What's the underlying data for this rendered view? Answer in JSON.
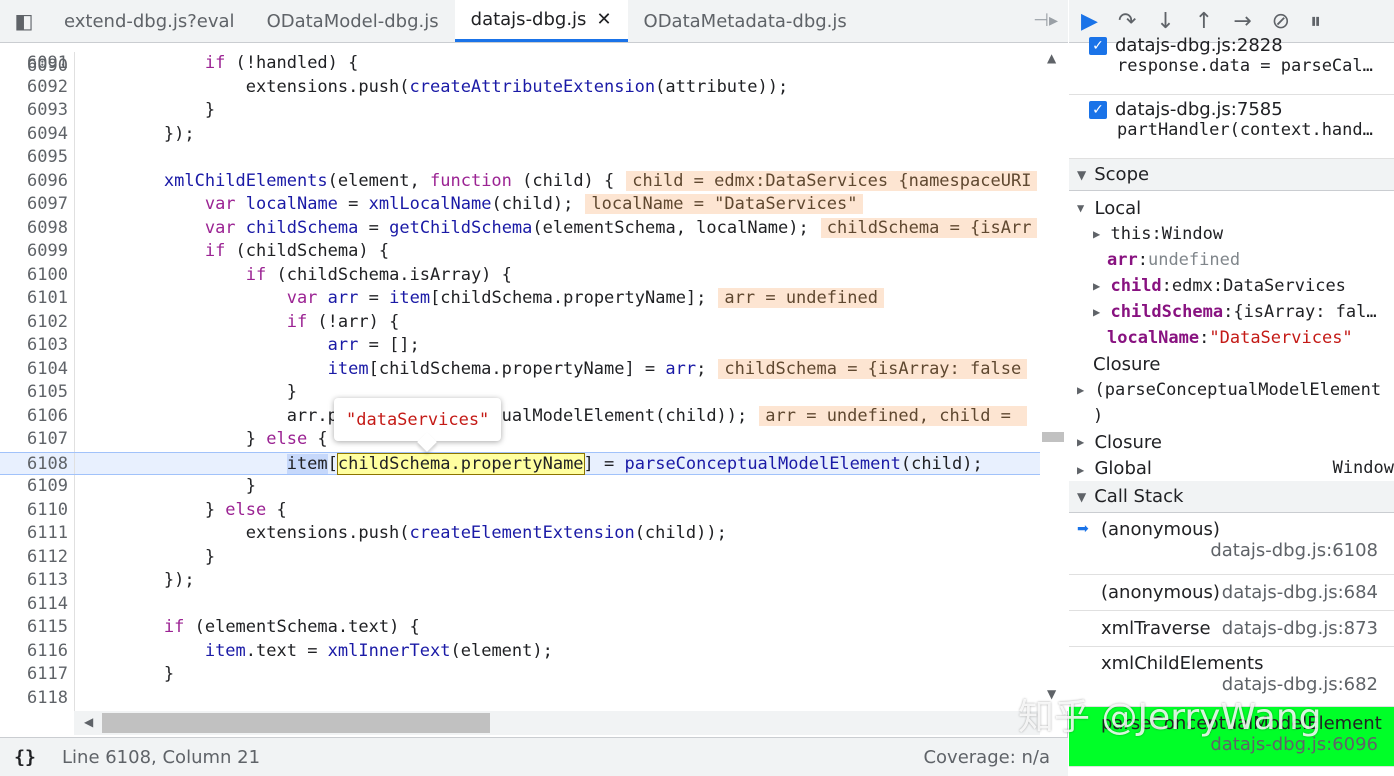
{
  "tabs": [
    {
      "label": "extend-dbg.js?eval",
      "active": false
    },
    {
      "label": "ODataModel-dbg.js",
      "active": false
    },
    {
      "label": "datajs-dbg.js",
      "active": true,
      "close": "✕"
    },
    {
      "label": "ODataMetadata-dbg.js",
      "active": false
    }
  ],
  "code_top_partial": "6090",
  "code_lines": [
    {
      "n": "6091",
      "html": "            <span class='kw'>if</span> (!handled) {"
    },
    {
      "n": "6092",
      "html": "                extensions.push(<span class='fn'>createAttributeExtension</span>(attribute));"
    },
    {
      "n": "6093",
      "html": "            }"
    },
    {
      "n": "6094",
      "html": "        });"
    },
    {
      "n": "6095",
      "html": ""
    },
    {
      "n": "6096",
      "html": "        <span class='fn'>xmlChildElements</span>(element, <span class='kw'>function</span> (child) {<span class='inl'>child = edmx:DataServices {namespaceURI</span>"
    },
    {
      "n": "6097",
      "html": "            <span class='kw'>var</span> <span class='vf'>localName</span> = <span class='fn'>xmlLocalName</span>(child);<span class='inl'>localName = \"DataServices\"</span>"
    },
    {
      "n": "6098",
      "html": "            <span class='kw'>var</span> <span class='vf'>childSchema</span> = <span class='fn'>getChildSchema</span>(elementSchema, localName);<span class='inl'>childSchema = {isArr</span>"
    },
    {
      "n": "6099",
      "html": "            <span class='kw'>if</span> (childSchema) {"
    },
    {
      "n": "6100",
      "html": "                <span class='kw'>if</span> (childSchema.isArray) {"
    },
    {
      "n": "6101",
      "html": "                    <span class='kw'>var</span> <span class='vf'>arr</span> = <span class='vf'>item</span>[childSchema.propertyName];<span class='inl'>arr = undefined</span>"
    },
    {
      "n": "6102",
      "html": "                    <span class='kw'>if</span> (!arr) {"
    },
    {
      "n": "6103",
      "html": "                        <span class='vf'>arr</span> = [];"
    },
    {
      "n": "6104",
      "html": "                        <span class='vf'>item</span>[childSchema.propertyName] = <span class='vf'>arr</span>;<span class='inl'>childSchema = {isArray: false</span>"
    },
    {
      "n": "6105",
      "html": "                    }"
    },
    {
      "n": "6106",
      "html": "                    arr.push(parseConceptualModelElement(child));<span class='inl'>arr = undefined, child = </span>"
    },
    {
      "n": "6107",
      "html": "                } <span class='kw'>else</span> {"
    },
    {
      "n": "6108",
      "html": "                    <span class='sel-blue'>item</span>[<span class='sel-yel'>childSchema.propertyName</span>] = <span class='fn'>parseConceptualModelElement</span>(child);",
      "current": true
    },
    {
      "n": "6109",
      "html": "                }"
    },
    {
      "n": "6110",
      "html": "            } <span class='kw'>else</span> {"
    },
    {
      "n": "6111",
      "html": "                extensions.push(<span class='fn'>createElementExtension</span>(child));"
    },
    {
      "n": "6112",
      "html": "            }"
    },
    {
      "n": "6113",
      "html": "        });"
    },
    {
      "n": "6114",
      "html": ""
    },
    {
      "n": "6115",
      "html": "        <span class='kw'>if</span> (elementSchema.text) {"
    },
    {
      "n": "6116",
      "html": "            <span class='vf'>item</span>.text = <span class='fn'>xmlInnerText</span>(element);"
    },
    {
      "n": "6117",
      "html": "        }"
    },
    {
      "n": "6118",
      "html": ""
    },
    {
      "n": "6119",
      "html": ""
    }
  ],
  "popover_value": "\"dataServices\"",
  "status": {
    "braces": "{}",
    "position": "Line 6108, Column 21",
    "coverage": "Coverage: n/a"
  },
  "debugger_toolbar": [
    "▶",
    "↷",
    "↓",
    "↑",
    "→",
    "⊘",
    "⏸"
  ],
  "breakpoints": [
    {
      "file": "datajs-dbg.js:2828",
      "code": "response.data = parseCal…",
      "checked": true
    },
    {
      "file": "datajs-dbg.js:7585",
      "code": "partHandler(context.hand…",
      "checked": true
    }
  ],
  "scope": {
    "title": "Scope",
    "local_title": "Local",
    "rows": [
      {
        "arrow": "▶",
        "key": "this",
        "sep": ": ",
        "val": "Window",
        "style": "plain"
      },
      {
        "arrow": "",
        "key": "arr",
        "sep": ": ",
        "val": "undefined",
        "style": "und"
      },
      {
        "arrow": "▶",
        "key": "child",
        "sep": ": ",
        "val": "edmx:DataServices",
        "style": "obj"
      },
      {
        "arrow": "▶",
        "key": "childSchema",
        "sep": ": ",
        "val": "{isArray: fal…",
        "style": "obj"
      },
      {
        "arrow": "",
        "key": "localName",
        "sep": ": ",
        "val": "\"DataServices\"",
        "style": "str"
      }
    ],
    "closure1_title": "Closure",
    "closure1_sub": "(parseConceptualModelElement",
    "closure1_end": ")",
    "closure2_title": "Closure",
    "global_title": "Global",
    "global_val": "Window"
  },
  "call_stack": {
    "title": "Call Stack",
    "frames": [
      {
        "name": "(anonymous)",
        "file": "datajs-dbg.js:6108",
        "current": true
      },
      {
        "name": "(anonymous)",
        "file": "datajs-dbg.js:684"
      },
      {
        "name": "xmlTraverse",
        "file": "datajs-dbg.js:873"
      },
      {
        "name": "xmlChildElements",
        "file": "datajs-dbg.js:682"
      },
      {
        "name": "parseConceptualModelElement",
        "file": "datajs-dbg.js:6096",
        "highlight": true
      }
    ]
  },
  "watermark": "知乎 @JerryWang",
  "colors": {
    "accent": "#1a73e8",
    "highlight_green": "#00ff28",
    "inline_value_bg": "#fde5d2"
  }
}
